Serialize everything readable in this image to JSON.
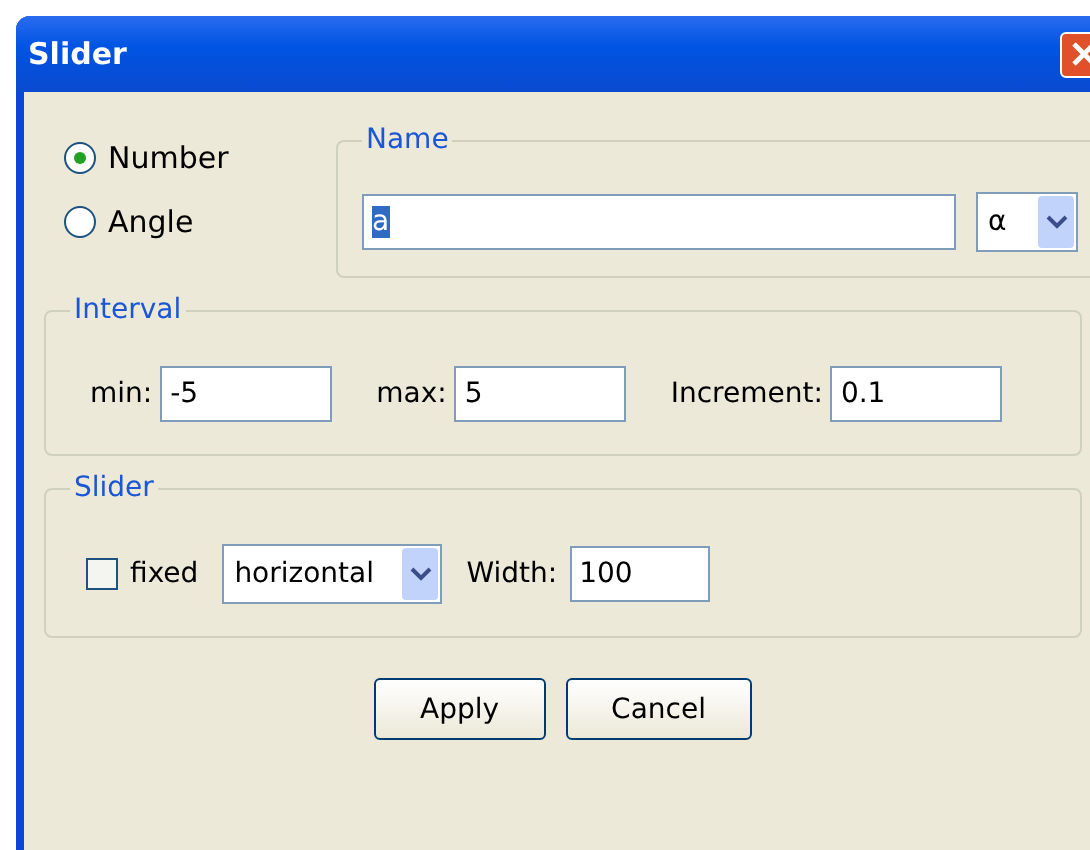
{
  "window": {
    "title": "Slider"
  },
  "type_options": [
    {
      "label": "Number",
      "selected": true
    },
    {
      "label": "Angle",
      "selected": false
    }
  ],
  "name_group": {
    "title": "Name",
    "value": "a",
    "text_selected": true,
    "symbol": "α"
  },
  "interval": {
    "title": "Interval",
    "fields": [
      {
        "label": "min:",
        "value": "-5"
      },
      {
        "label": "max:",
        "value": "5"
      },
      {
        "label": "Increment:",
        "value": "0.1"
      }
    ]
  },
  "slider": {
    "title": "Slider",
    "fixed": {
      "label": "fixed",
      "checked": false
    },
    "orientation": "horizontal",
    "width_label": "Width:",
    "width_value": "100"
  },
  "buttons": [
    "Apply",
    "Cancel"
  ]
}
